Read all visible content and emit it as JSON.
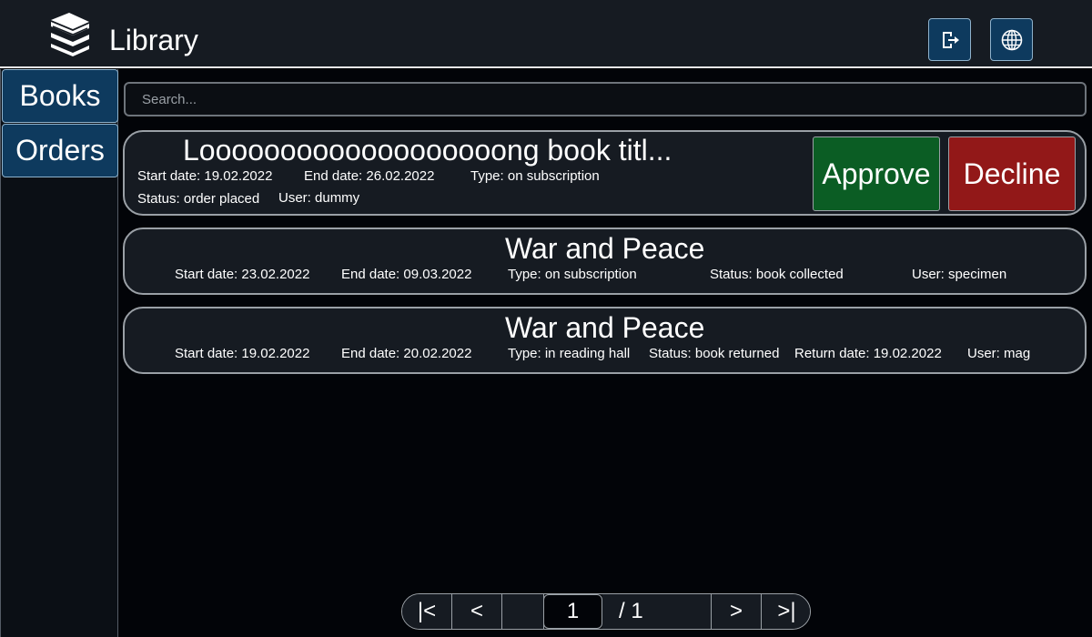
{
  "header": {
    "title": "Library",
    "logo_icon": "books-stack-icon",
    "logout_icon": "logout-icon",
    "language_icon": "globe-icon"
  },
  "sidebar": {
    "items": [
      {
        "label": "Books"
      },
      {
        "label": "Orders"
      }
    ]
  },
  "search": {
    "placeholder": "Search...",
    "value": ""
  },
  "orders": [
    {
      "title": "Looooooooooooooooooong book titl...",
      "start": "Start date: 19.02.2022",
      "end": "End date: 26.02.2022",
      "type": "Type: on subscription",
      "status": "Status: order placed",
      "user": "User: dummy",
      "approve_label": "Approve",
      "decline_label": "Decline"
    },
    {
      "title": "War and Peace",
      "start": "Start date: 23.02.2022",
      "end": "End date: 09.03.2022",
      "type": "Type: on subscription",
      "status": "Status: book collected",
      "user": "User: specimen"
    },
    {
      "title": "War and Peace",
      "start": "Start date: 19.02.2022",
      "end": "End date: 20.02.2022",
      "type": "Type: in reading hall",
      "status": "Status: book returned",
      "return_date": "Return date: 19.02.2022",
      "user": "User: mag"
    }
  ],
  "pagination": {
    "first": "|<",
    "prev": "<",
    "current": "1",
    "total": "/ 1",
    "next": ">",
    "last": ">|"
  },
  "colors": {
    "background": "#020408",
    "panel": "#161b22",
    "primary": "#0e3a5e",
    "approve": "#0b5d24",
    "decline": "#921818"
  }
}
